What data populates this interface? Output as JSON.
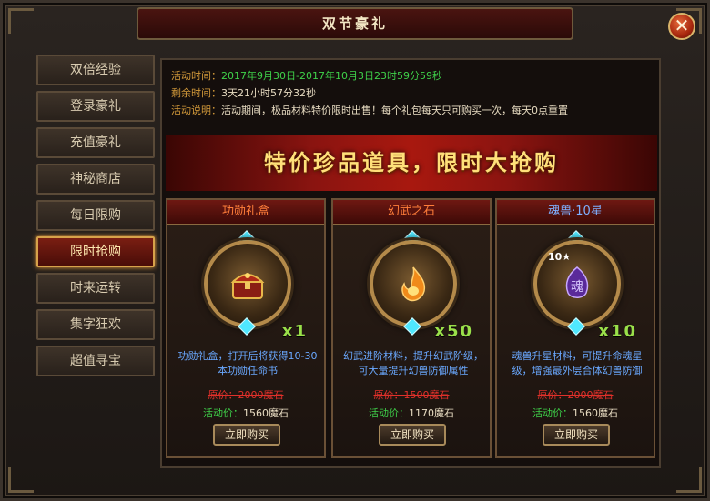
{
  "window": {
    "title": "双节豪礼",
    "close_label": "✕"
  },
  "sidebar": {
    "items": [
      {
        "label": "双倍经验",
        "active": false
      },
      {
        "label": "登录豪礼",
        "active": false
      },
      {
        "label": "充值豪礼",
        "active": false
      },
      {
        "label": "神秘商店",
        "active": false
      },
      {
        "label": "每日限购",
        "active": false
      },
      {
        "label": "限时抢购",
        "active": true
      },
      {
        "label": "时来运转",
        "active": false
      },
      {
        "label": "集字狂欢",
        "active": false
      },
      {
        "label": "超值寻宝",
        "active": false
      }
    ]
  },
  "info": {
    "time_label": "活动时间：",
    "time_value": "2017年9月30日-2017年10月3日23时59分59秒",
    "remain_label": "剩余时间：",
    "remain_value": "3天21小时57分32秒",
    "desc_label": "活动说明：",
    "desc_value": "活动期间，极品材料特价限时出售！每个礼包每天只可购买一次，每天0点重置"
  },
  "banner": {
    "text": "特价珍品道具，限时大抢购"
  },
  "cards": [
    {
      "name": "功勋礼盒",
      "icon": "treasure-chest-icon",
      "quantity": "x1",
      "description": "功勋礼盒，打开后将获得10-30本功勋任命书",
      "original_price": "原价：2000魔石",
      "sale_label": "活动价：",
      "sale_price": "1560魔石",
      "buy_label": "立即购买"
    },
    {
      "name": "幻武之石",
      "icon": "flame-stone-icon",
      "quantity": "x50",
      "description": "幻武进阶材料，提升幻武阶级，可大量提升幻兽防御属性",
      "original_price": "原价：1500魔石",
      "sale_label": "活动价：",
      "sale_price": "1170魔石",
      "buy_label": "立即购买"
    },
    {
      "name": "魂兽·10星",
      "icon": "soul-crystal-icon",
      "quantity": "x10",
      "star_badge": "10★",
      "soul_char": "魂",
      "description": "魂兽升星材料，可提升命魂星级，增强最外层合体幻兽防御",
      "original_price": "原价：2000魔石",
      "sale_label": "活动价：",
      "sale_price": "1560魔石",
      "buy_label": "立即购买"
    }
  ]
}
